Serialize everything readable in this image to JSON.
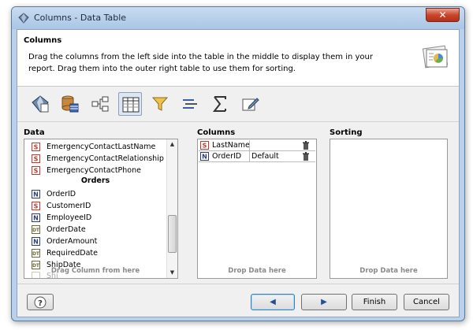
{
  "window": {
    "title": "Columns - Data Table",
    "close_label": "✕"
  },
  "header": {
    "title": "Columns",
    "description": "Drag the columns from the left side into the table in the middle to display them in your report. Drag them into the outer right table to use them for sorting."
  },
  "toolbar": {
    "tools": [
      {
        "icon": "report-wizard-icon",
        "active": false
      },
      {
        "icon": "database-icon",
        "active": false
      },
      {
        "icon": "hierarchy-icon",
        "active": false
      },
      {
        "icon": "table-columns-icon",
        "active": true
      },
      {
        "icon": "filter-icon",
        "active": false
      },
      {
        "icon": "group-lines-icon",
        "active": false
      },
      {
        "icon": "sum-icon",
        "active": false
      },
      {
        "icon": "edit-icon",
        "active": false
      }
    ]
  },
  "data_panel": {
    "label": "Data",
    "rows": [
      {
        "type": "S",
        "name": "EmergencyContactLastName"
      },
      {
        "type": "S",
        "name": "EmergencyContactRelationship"
      },
      {
        "type": "S",
        "name": "EmergencyContactPhone"
      },
      {
        "group": "Orders"
      },
      {
        "type": "N",
        "name": "OrderID"
      },
      {
        "type": "S",
        "name": "CustomerID"
      },
      {
        "type": "N",
        "name": "EmployeeID"
      },
      {
        "type": "DT",
        "name": "OrderDate"
      },
      {
        "type": "N",
        "name": "OrderAmount"
      },
      {
        "type": "DT",
        "name": "RequiredDate"
      },
      {
        "type": "DT",
        "name": "ShipDate"
      }
    ],
    "partial_row": "Shi",
    "hint": "Drag Column from here"
  },
  "columns_panel": {
    "label": "Columns",
    "rows": [
      {
        "type": "S",
        "name": "LastName",
        "default": ""
      },
      {
        "type": "N",
        "name": "OrderID",
        "default": "Default"
      }
    ],
    "hint": "Drop Data here"
  },
  "sorting_panel": {
    "label": "Sorting",
    "hint": "Drop Data here"
  },
  "buttons": {
    "help": "?",
    "back": "◀",
    "next": "▶",
    "finish": "Finish",
    "cancel": "Cancel"
  },
  "colors": {
    "string_badge": "#c0392b",
    "number_badge": "#2c3e70",
    "date_badge": "#6b6b3a",
    "accent": "#3c7fb1"
  }
}
